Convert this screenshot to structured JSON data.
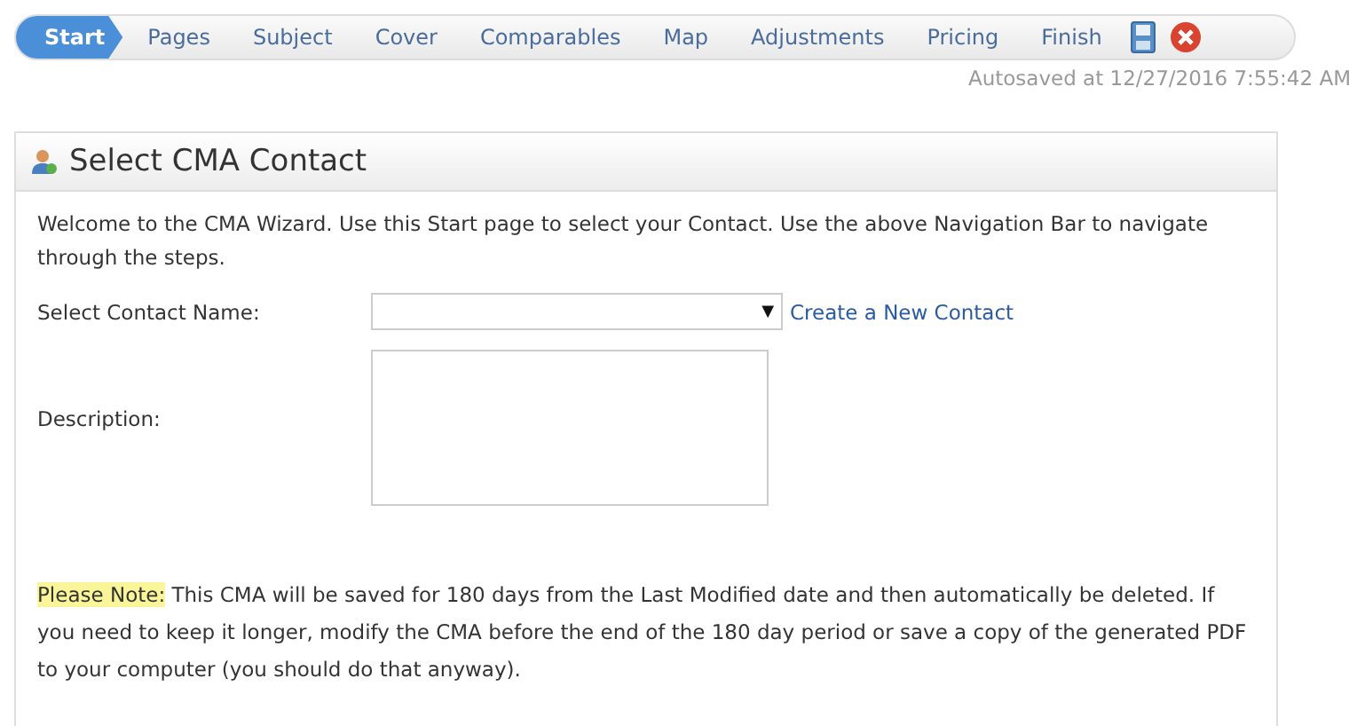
{
  "steps": [
    {
      "label": "Start",
      "selected": true
    },
    {
      "label": "Pages",
      "selected": false
    },
    {
      "label": "Subject",
      "selected": false
    },
    {
      "label": "Cover",
      "selected": false
    },
    {
      "label": "Comparables",
      "selected": false
    },
    {
      "label": "Map",
      "selected": false
    },
    {
      "label": "Adjustments",
      "selected": false
    },
    {
      "label": "Pricing",
      "selected": false
    },
    {
      "label": "Finish",
      "selected": false
    }
  ],
  "autosave": "Autosaved at 12/27/2016 7:55:42 AM",
  "panel": {
    "title": "Select CMA Contact",
    "intro": "Welcome to the CMA Wizard. Use this Start page to select your Contact. Use the above Navigation Bar to navigate through the steps.",
    "contact_label": "Select Contact Name:",
    "dropdown_arrow": "▼",
    "create_link": "Create a New Contact",
    "description_label": "Description:",
    "note_label": "Please Note:",
    "note_text": "This CMA will be saved for 180 days from the Last Modified date and then automatically be deleted. If you need to keep it longer, modify the CMA before the end of the 180 day period or save a copy of the generated PDF to your computer (you should do that anyway)."
  }
}
